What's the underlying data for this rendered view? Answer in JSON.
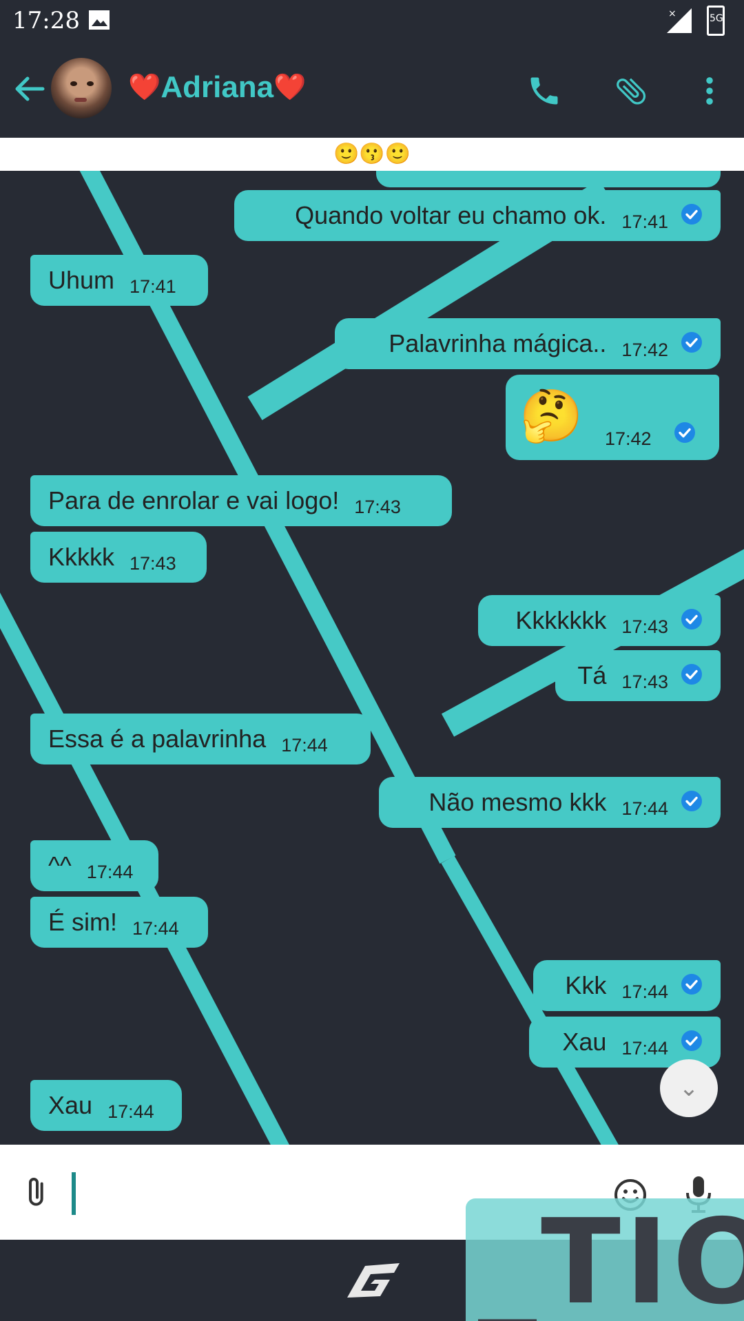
{
  "status_bar": {
    "time": "17:28",
    "network": "5G"
  },
  "header": {
    "back_icon": "arrow-left-icon",
    "contact_name": "Adriana",
    "name_heart": "❤️",
    "call_icon": "phone-icon",
    "attach_icon": "paperclip-icon",
    "menu_icon": "more-vertical-icon"
  },
  "banner": {
    "emojis": "🙂😗🙂"
  },
  "colors": {
    "accent": "#46c9c6",
    "background": "#272b34",
    "tick": "#1e88e5"
  },
  "messages": [
    {
      "dir": "out",
      "text": "Quando voltar eu chamo ok.",
      "time": "17:41"
    },
    {
      "dir": "in",
      "text": "Uhum",
      "time": "17:41"
    },
    {
      "dir": "out",
      "text": "Palavrinha mágica..",
      "time": "17:42"
    },
    {
      "dir": "out",
      "text": "🤔",
      "time": "17:42"
    },
    {
      "dir": "in",
      "text": "Para de enrolar e vai logo!",
      "time": "17:43"
    },
    {
      "dir": "in",
      "text": "Kkkkk",
      "time": "17:43"
    },
    {
      "dir": "out",
      "text": "Kkkkkkk",
      "time": "17:43"
    },
    {
      "dir": "out",
      "text": "Tá",
      "time": "17:43"
    },
    {
      "dir": "in",
      "text": "Essa é a palavrinha",
      "time": "17:44"
    },
    {
      "dir": "out",
      "text": "Não mesmo kkk",
      "time": "17:44"
    },
    {
      "dir": "in",
      "text": "^^",
      "time": "17:44"
    },
    {
      "dir": "in",
      "text": "É sim!",
      "time": "17:44"
    },
    {
      "dir": "out",
      "text": "Kkk",
      "time": "17:44"
    },
    {
      "dir": "out",
      "text": "Xau",
      "time": "17:44"
    },
    {
      "dir": "in",
      "text": "Xau",
      "time": "17:44"
    }
  ],
  "scroll_down_glyph": "⌄",
  "input": {
    "text": ""
  },
  "watermark": {
    "text": "_TIOLU"
  }
}
